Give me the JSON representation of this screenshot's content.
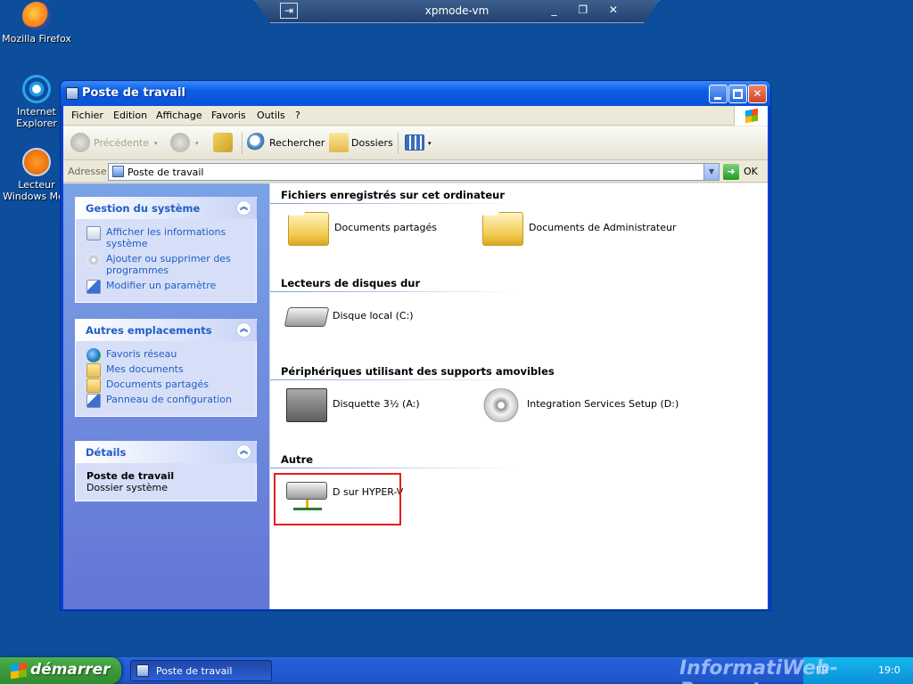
{
  "remote_bar": {
    "title": "xpmode-vm",
    "pin_glyph": "⇥",
    "controls": "_ ❐ ✕"
  },
  "desktop": {
    "icons": [
      {
        "label": "Mozilla Firefox"
      },
      {
        "label": "Internet Explorer"
      },
      {
        "label": "Lecteur Windows Med"
      }
    ]
  },
  "window": {
    "title": "Poste de travail",
    "menu": [
      "Fichier",
      "Edition",
      "Affichage",
      "Favoris",
      "Outils",
      "?"
    ],
    "toolbar": {
      "back": "Précédente",
      "search": "Rechercher",
      "folders": "Dossiers",
      "dropdown_glyph": "▾"
    },
    "address": {
      "label": "Adresse",
      "value": "Poste de travail",
      "go_label": "OK",
      "go_glyph": "➜",
      "dropdown_glyph": "▼"
    },
    "taskpane": {
      "collapse_glyph": "︽",
      "system": {
        "title": "Gestion du système",
        "links": [
          "Afficher les informations système",
          "Ajouter ou supprimer des programmes",
          "Modifier un paramètre"
        ]
      },
      "other": {
        "title": "Autres emplacements",
        "links": [
          "Favoris réseau",
          "Mes documents",
          "Documents partagés",
          "Panneau de configuration"
        ]
      },
      "details": {
        "title": "Détails",
        "name": "Poste de travail",
        "type": "Dossier système"
      }
    },
    "content": {
      "groups": [
        {
          "title": "Fichiers enregistrés sur cet ordinateur",
          "items": [
            "Documents partagés",
            "Documents de Administrateur"
          ]
        },
        {
          "title": "Lecteurs de disques dur",
          "items": [
            "Disque local (C:)"
          ]
        },
        {
          "title": "Périphériques utilisant des supports amovibles",
          "items": [
            "Disquette 3½ (A:)",
            "Integration Services Setup (D:)"
          ]
        },
        {
          "title": "Autre",
          "items": [
            "D sur HYPER-V"
          ]
        }
      ],
      "highlight_color": "#e1201b"
    }
  },
  "taskbar": {
    "start_label": "démarrer",
    "task_button": "Poste de travail",
    "lang": "FR",
    "clock": "19:0"
  },
  "watermark": "InformatiWeb-Pro.net",
  "colors": {
    "desktop": "#0c4d9c",
    "titlebar": "#0a52d6",
    "link": "#215dc6",
    "start": "#3c9a3c"
  }
}
